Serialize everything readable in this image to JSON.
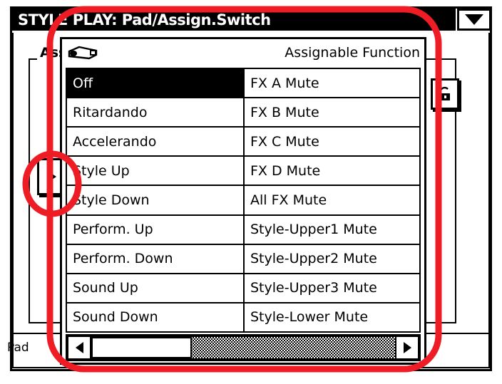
{
  "window": {
    "title": "STYLE PLAY: Pad/Assign.Switch",
    "menu_icon": "triangle-down-icon"
  },
  "background_page": {
    "groupbox_label": "Ass",
    "tab_label": "Pad",
    "side_button_icon": "triangle-right-icon",
    "lock_button_icon": "lock-icon"
  },
  "popup": {
    "header_icon": "pedal-icon",
    "title": "Assignable Function",
    "columns": [
      {
        "name": "left-column",
        "items": [
          {
            "label": "Off",
            "selected": true
          },
          {
            "label": "Ritardando",
            "selected": false
          },
          {
            "label": "Accelerando",
            "selected": false
          },
          {
            "label": "Style Up",
            "selected": false
          },
          {
            "label": "Style Down",
            "selected": false
          },
          {
            "label": "Perform. Up",
            "selected": false
          },
          {
            "label": "Perform. Down",
            "selected": false
          },
          {
            "label": "Sound Up",
            "selected": false
          },
          {
            "label": "Sound Down",
            "selected": false
          }
        ]
      },
      {
        "name": "right-column",
        "items": [
          {
            "label": "FX A Mute",
            "selected": false
          },
          {
            "label": "FX B Mute",
            "selected": false
          },
          {
            "label": "FX C Mute",
            "selected": false
          },
          {
            "label": "FX D Mute",
            "selected": false
          },
          {
            "label": "All FX Mute",
            "selected": false
          },
          {
            "label": "Style-Upper1 Mute",
            "selected": false
          },
          {
            "label": "Style-Upper2 Mute",
            "selected": false
          },
          {
            "label": "Style-Upper3 Mute",
            "selected": false
          },
          {
            "label": "Style-Lower Mute",
            "selected": false
          }
        ]
      }
    ],
    "scrollbar": {
      "left_arrow_icon": "triangle-left-icon",
      "right_arrow_icon": "triangle-right-icon",
      "thumb_position_percent": 0,
      "thumb_width_percent": 33
    }
  },
  "annotations": {
    "color": "#ee1c24",
    "shapes": [
      {
        "name": "highlight-rounded-rect-popup",
        "type": "rounded-rect"
      },
      {
        "name": "highlight-ellipse-side-button",
        "type": "ellipse"
      }
    ]
  }
}
